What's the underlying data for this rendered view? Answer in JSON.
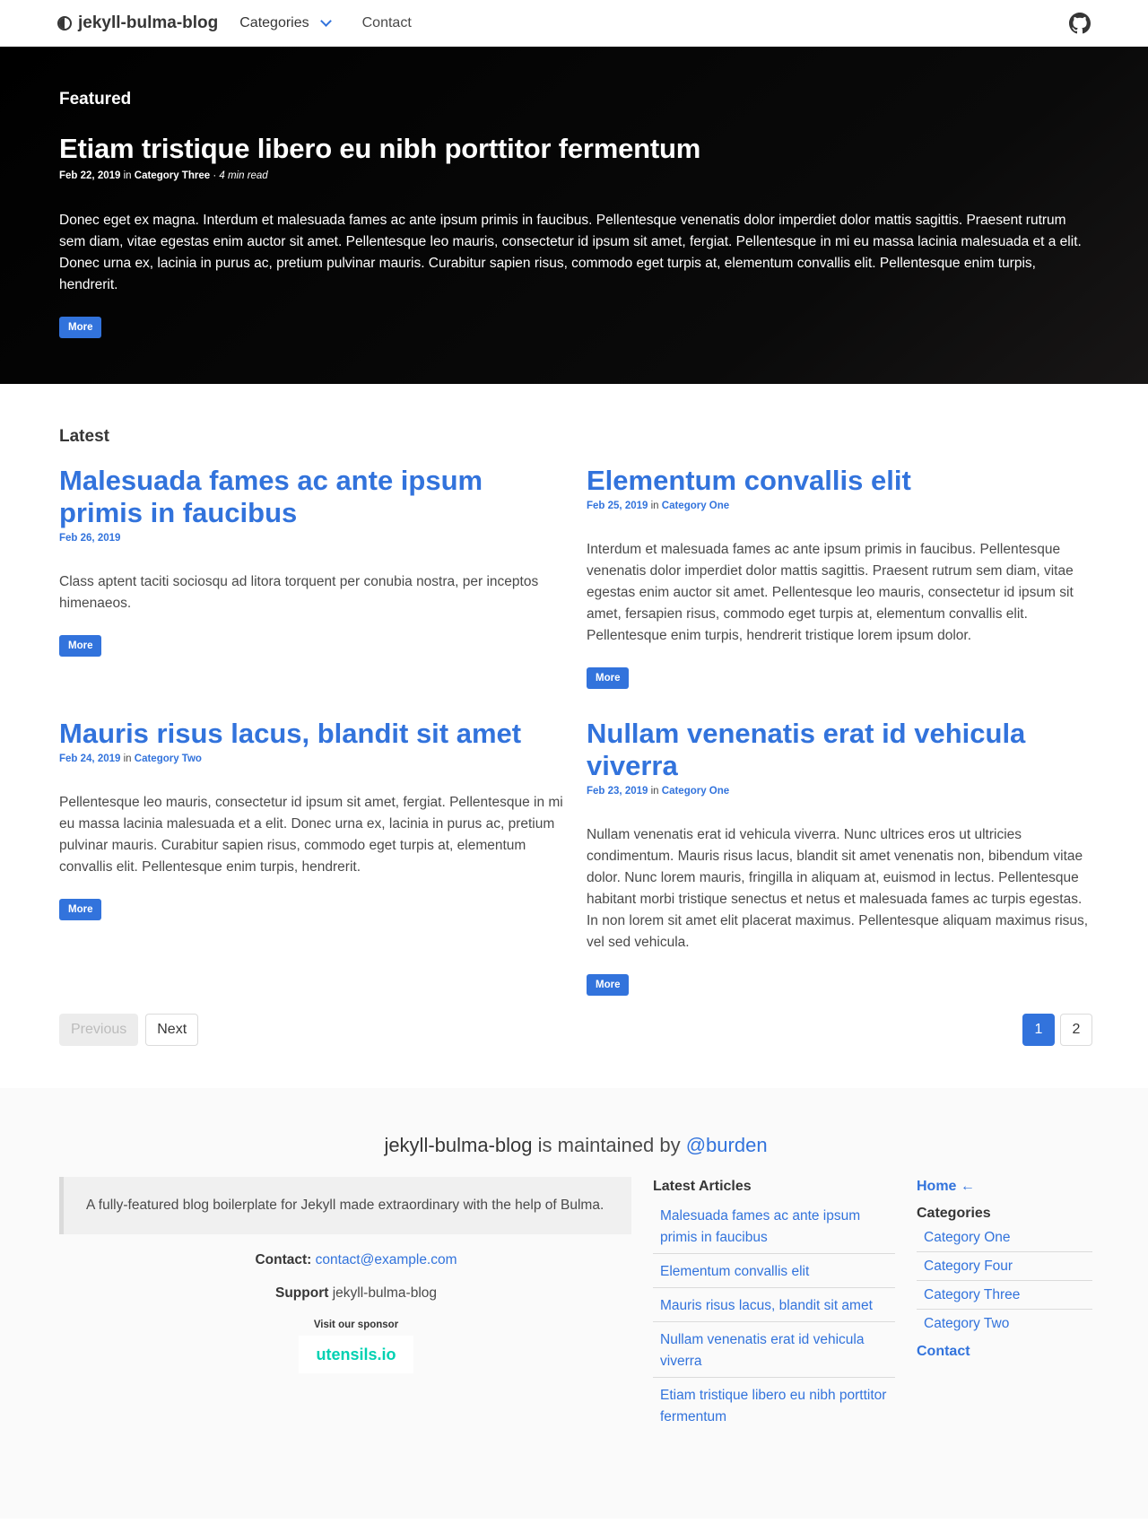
{
  "nav": {
    "brand": "jekyll-bulma-blog",
    "categories_label": "Categories",
    "contact_label": "Contact"
  },
  "hero": {
    "label": "Featured",
    "title": "Etiam tristique libero eu nibh porttitor fermentum",
    "date": "Feb 22, 2019",
    "in": "in",
    "category": "Category Three",
    "sep": "·",
    "read_time": "4 min read",
    "excerpt": "Donec eget ex magna. Interdum et malesuada fames ac ante ipsum primis in faucibus. Pellentesque venenatis dolor imperdiet dolor mattis sagittis. Praesent rutrum sem diam, vitae egestas enim auctor sit amet. Pellentesque leo mauris, consectetur id ipsum sit amet, fergiat. Pellentesque in mi eu massa lacinia malesuada et a elit. Donec urna ex, lacinia in purus ac, pretium pulvinar mauris. Curabitur sapien risus, commodo eget turpis at, elementum convallis elit. Pellentesque enim turpis, hendrerit.",
    "more": "More"
  },
  "latest": {
    "title": "Latest",
    "posts": [
      {
        "title": "Malesuada fames ac ante ipsum primis in faucibus",
        "date": "Feb 26, 2019",
        "in": "",
        "category": "",
        "excerpt": "Class aptent taciti sociosqu ad litora torquent per conubia nostra, per inceptos himenaeos.",
        "more": "More"
      },
      {
        "title": "Elementum convallis elit",
        "date": "Feb 25, 2019",
        "in": "in",
        "category": "Category One",
        "excerpt": "Interdum et malesuada fames ac ante ipsum primis in faucibus. Pellentesque venenatis dolor imperdiet dolor mattis sagittis. Praesent rutrum sem diam, vitae egestas enim auctor sit amet. Pellentesque leo mauris, consectetur id ipsum sit amet, fersapien risus, commodo eget turpis at, elementum convallis elit. Pellentesque enim turpis, hendrerit tristique lorem ipsum dolor.",
        "more": "More"
      },
      {
        "title": "Mauris risus lacus, blandit sit amet",
        "date": "Feb 24, 2019",
        "in": "in",
        "category": "Category Two",
        "excerpt": "Pellentesque leo mauris, consectetur id ipsum sit amet, fergiat. Pellentesque in mi eu massa lacinia malesuada et a elit. Donec urna ex, lacinia in purus ac, pretium pulvinar mauris. Curabitur sapien risus, commodo eget turpis at, elementum convallis elit. Pellentesque enim turpis, hendrerit.",
        "more": "More"
      },
      {
        "title": "Nullam venenatis erat id vehicula viverra",
        "date": "Feb 23, 2019",
        "in": "in",
        "category": "Category One",
        "excerpt": "Nullam venenatis erat id vehicula viverra. Nunc ultrices eros ut ultricies condimentum. Mauris risus lacus, blandit sit amet venenatis non, bibendum vitae dolor. Nunc lorem mauris, fringilla in aliquam at, euismod in lectus. Pellentesque habitant morbi tristique senectus et netus et malesuada fames ac turpis egestas. In non lorem sit amet elit placerat maximus. Pellentesque aliquam maximus risus, vel sed vehicula.",
        "more": "More"
      }
    ]
  },
  "pagination": {
    "previous": "Previous",
    "next": "Next",
    "pages": [
      "1",
      "2"
    ],
    "current": "1"
  },
  "footer": {
    "name": "jekyll-bulma-blog",
    "maintained": " is maintained by ",
    "author": "@burden",
    "quote": "A fully-featured blog boilerplate for Jekyll made extraordinary with the help of Bulma.",
    "contact_label": "Contact:",
    "contact_email": "contact@example.com",
    "support_label": "Support",
    "support_value": "jekyll-bulma-blog",
    "sponsor_label": "Visit our sponsor",
    "sponsor_name": "utensils.io",
    "latest_title": "Latest Articles",
    "latest_articles": [
      "Malesuada fames ac ante ipsum primis in faucibus",
      "Elementum convallis elit",
      "Mauris risus lacus, blandit sit amet",
      "Nullam venenatis erat id vehicula viverra",
      "Etiam tristique libero eu nibh porttitor fermentum"
    ],
    "menu_home": "Home ←",
    "menu_categories": "Categories",
    "categories": [
      "Category One",
      "Category Four",
      "Category Three",
      "Category Two"
    ],
    "menu_contact": "Contact"
  },
  "colors": {
    "primary": "#3273dc",
    "sponsor": "#00d1b2",
    "hero_bg": "#000000"
  }
}
